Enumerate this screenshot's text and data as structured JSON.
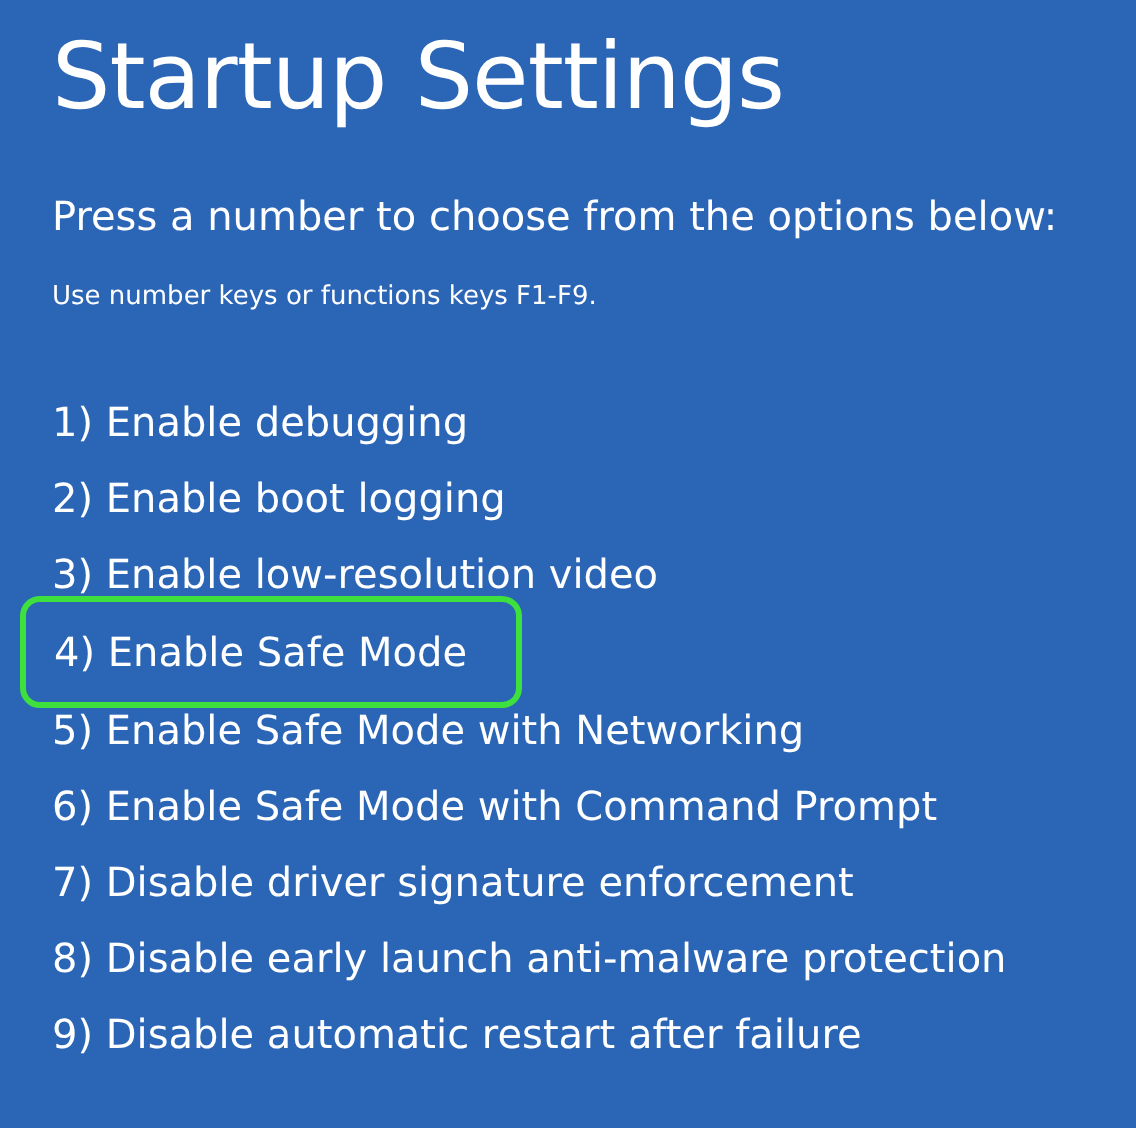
{
  "title": "Startup Settings",
  "prompt": "Press a number to choose from the options below:",
  "hint": "Use number keys or functions keys F1-F9.",
  "options": [
    {
      "label": "1) Enable debugging",
      "highlighted": false
    },
    {
      "label": "2) Enable boot logging",
      "highlighted": false
    },
    {
      "label": "3) Enable low-resolution video",
      "highlighted": false
    },
    {
      "label": "4) Enable Safe Mode",
      "highlighted": true
    },
    {
      "label": "5) Enable Safe Mode with Networking",
      "highlighted": false
    },
    {
      "label": "6) Enable Safe Mode with Command Prompt",
      "highlighted": false
    },
    {
      "label": "7) Disable driver signature enforcement",
      "highlighted": false
    },
    {
      "label": "8) Disable early launch anti-malware protection",
      "highlighted": false
    },
    {
      "label": "9) Disable automatic restart after failure",
      "highlighted": false
    }
  ]
}
